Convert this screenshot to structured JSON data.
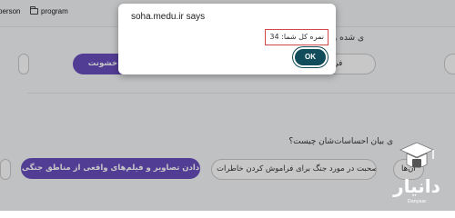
{
  "bookmarks": [
    {
      "label": "person"
    },
    {
      "label": "program"
    }
  ],
  "question1": {
    "text": "ی شده و نباید سرکوب شود؟",
    "options": [
      "فراموشی کامل",
      "ا و خشونت"
    ]
  },
  "question2": {
    "text": "ی بیان احساسات‌شان چیست؟",
    "options": [
      "نشان دادن تصاویر و فیلم‌های واقعی از مناطق جنگی",
      "آن‌ها",
      "ها از صحبت در مورد جنگ برای فراموش کردن خاطرات"
    ]
  },
  "dialog": {
    "title": "soha.medu.ir says",
    "message": "نمره کل شما: 34",
    "ok_label": "OK"
  },
  "logo": {
    "name": "دانیار",
    "subtitle": "Danyaar"
  }
}
